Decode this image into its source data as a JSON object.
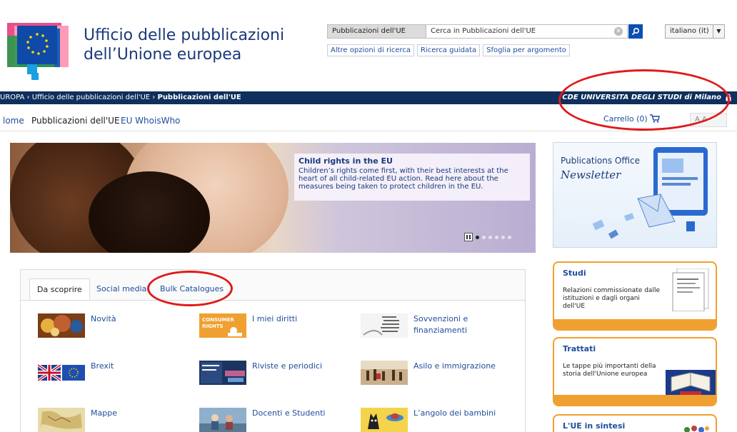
{
  "header": {
    "title_line1": "Ufficio delle pubblicazioni",
    "title_line2": "dell’Unione europea",
    "search_scope": "Pubblicazioni dell'UE",
    "search_placeholder": "Cerca in Pubblicazioni dell'UE",
    "language": "italiano (it)",
    "search_links": [
      "Altre opzioni di ricerca",
      "Ricerca guidata",
      "Sfoglia per argomento"
    ]
  },
  "breadcrumb": {
    "part1": "UROPA › Ufficio delle pubblicazioni dell'UE › ",
    "current": "Pubblicazioni dell'UE",
    "user": "CDE UNIVERSITA DEGLI STUDI di Milano"
  },
  "nav": {
    "items": [
      "lome",
      "Pubblicazioni dell'UE",
      "EU WhoisWho"
    ],
    "cart": "Carrello (0)",
    "font_tools": "A A"
  },
  "hero": {
    "title": "Child rights in the EU",
    "text": "Children’s rights come first, with their best interests at the heart of all child-related EU action. Read here about the measures being taken to protect children in the EU."
  },
  "tabs": [
    "Da scoprire",
    "Social media",
    "Bulk Catalogues"
  ],
  "grid": [
    {
      "label": "Novità",
      "thumb": "#8a4a20"
    },
    {
      "label": "I miei diritti",
      "thumb": "#f0a030",
      "thumb_text": "CONSUMER RIGHTS"
    },
    {
      "label": "Sovvenzioni e finanziamenti",
      "thumb": "#e4e4e4"
    },
    {
      "label": "Brexit",
      "thumb": "#1f3f8f"
    },
    {
      "label": "Riviste e periodici",
      "thumb": "#1b3560"
    },
    {
      "label": "Asilo e immigrazione",
      "thumb": "#b08a5e"
    },
    {
      "label": "Mappe",
      "thumb": "#d8c88a"
    },
    {
      "label": "Docenti e Studenti",
      "thumb": "#6a8fb0"
    },
    {
      "label": "L’angolo dei bambini",
      "thumb": "#f2c83a"
    }
  ],
  "sidebar": {
    "newsletter_line1": "Publications Office",
    "newsletter_line2": "Newsletter",
    "promos": [
      {
        "title": "Studi",
        "text": "Relazioni commissionate dalle istituzioni e dagli organi dell'UE"
      },
      {
        "title": "Trattati",
        "text": "Le tappe più importanti della storia dell'Unione europea"
      },
      {
        "title": "L'UE in sintesi",
        "text": ""
      }
    ]
  },
  "colors": {
    "navy": "#0f2f5c",
    "link": "#1e4d9b",
    "orange": "#f0a030",
    "annotation_red": "#e01a1a"
  }
}
